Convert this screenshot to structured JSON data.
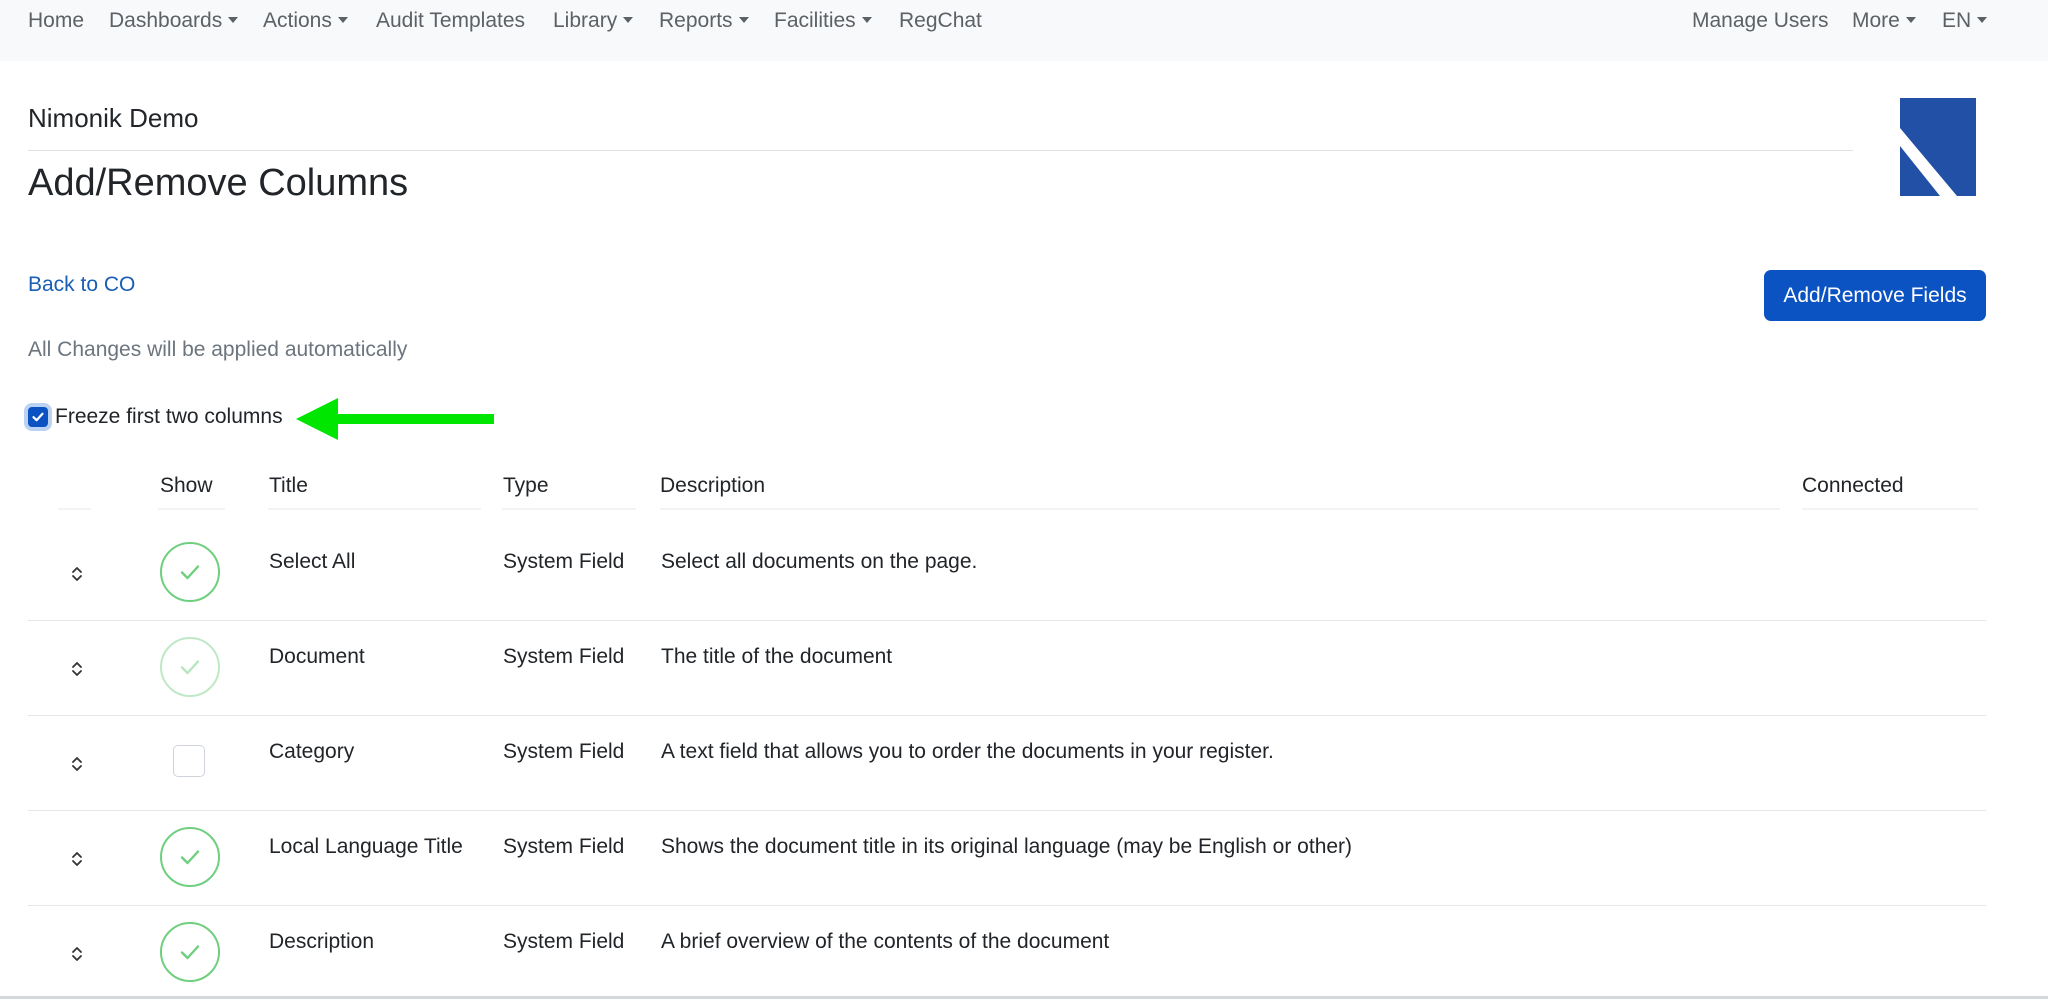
{
  "nav": {
    "left": [
      {
        "label": "Home",
        "dropdown": false
      },
      {
        "label": "Dashboards",
        "dropdown": true
      },
      {
        "label": "Actions",
        "dropdown": true
      },
      {
        "label": "Audit Templates",
        "dropdown": false
      },
      {
        "label": "Library",
        "dropdown": true
      },
      {
        "label": "Reports",
        "dropdown": true
      },
      {
        "label": "Facilities",
        "dropdown": true
      },
      {
        "label": "RegChat",
        "dropdown": false
      }
    ],
    "right": [
      {
        "label": "Manage Users",
        "dropdown": false
      },
      {
        "label": "More",
        "dropdown": true
      },
      {
        "label": "EN",
        "dropdown": true
      }
    ]
  },
  "header": {
    "org_name": "Nimonik Demo",
    "title": "Add/Remove Columns"
  },
  "actions": {
    "back_link": "Back to CO",
    "add_remove_fields": "Add/Remove Fields",
    "auto_apply_hint": "All Changes will be applied automatically"
  },
  "freeze": {
    "label": "Freeze first two columns",
    "checked": true
  },
  "table": {
    "headers": {
      "show": "Show",
      "title": "Title",
      "type": "Type",
      "description": "Description",
      "connected": "Connected"
    },
    "rows": [
      {
        "show": "checked",
        "title": "Select All",
        "type": "System Field",
        "description": "Select all documents on the page.",
        "connected": ""
      },
      {
        "show": "checked-disabled",
        "title": "Document",
        "type": "System Field",
        "description": "The title of the document",
        "connected": ""
      },
      {
        "show": "unchecked",
        "title": "Category",
        "type": "System Field",
        "description": "A text field that allows you to order the documents in your register.",
        "connected": ""
      },
      {
        "show": "checked",
        "title": "Local Language Title",
        "type": "System Field",
        "description": "Shows the document title in its original language (may be English or other)",
        "connected": ""
      },
      {
        "show": "checked",
        "title": "Description",
        "type": "System Field",
        "description": "A brief overview of the contents of the document",
        "connected": ""
      }
    ]
  },
  "colors": {
    "primary": "#0b52c2",
    "link": "#1a5fb4",
    "check_green": "#6fcf7f",
    "annotation_arrow": "#00e600",
    "logo_blue": "#2150a6"
  },
  "icons": {
    "drag_handle": "sort-arrows-icon",
    "show_checked": "check-circle-icon",
    "annotation": "green-arrow-icon"
  }
}
